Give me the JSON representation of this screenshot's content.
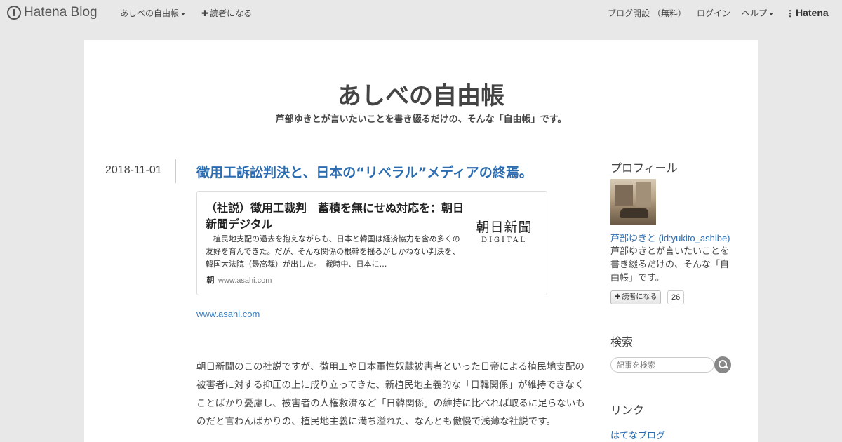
{
  "topbar": {
    "brand": "Hatena Blog",
    "blog_menu": "あしべの自由帳",
    "subscribe": "読者になる",
    "open_blog": "ブログ開設 （無料）",
    "login": "ログイン",
    "help": "ヘルプ",
    "hatena": "Hatena"
  },
  "blog": {
    "title": "あしべの自由帳",
    "description": "芦部ゆきとが言いたいことを書き綴るだけの、そんな「自由帳」です。"
  },
  "entry": {
    "date": "2018-11-01",
    "title": "徴用工訴訟判決と、日本の“リベラル”メディアの終焉。",
    "embed": {
      "title": "（社説）徴用工裁判　蓄積を無にせぬ対応を：朝日新聞デジタル",
      "excerpt": "　植民地支配の過去を抱えながらも、日本と韓国は経済協力を含め多くの友好を育んできた。だが、そんな関係の根幹を揺るがしかねない判決を、韓国大法院（最高裁）が出した。　戦時中、日本に…",
      "thumb_main": "朝日新聞",
      "thumb_sub": "DIGITAL",
      "favicon": "朝",
      "domain": "www.asahi.com"
    },
    "source_link": "www.asahi.com",
    "body": "朝日新聞のこの社説ですが、徴用工や日本軍性奴隷被害者といった日帝による植民地支配の被害者に対する抑圧の上に成り立ってきた、新植民地主義的な「日韓関係」が維持できなくことばかり憂慮し、被害者の人権救済など「日韓関係」の維持に比べれば取るに足らないものだと言わんばかりの、植民地主義に満ち溢れた、なんとも傲慢で浅薄な社説です。"
  },
  "sidebar": {
    "profile_heading": "プロフィール",
    "profile_name": "芦部ゆきと (id:yukito_ashibe)",
    "profile_desc": "芦部ゆきとが言いたいことを書き綴るだけの、そんな「自由帳」です。",
    "follow_label": "読者になる",
    "follow_count": "26",
    "search_heading": "検索",
    "search_placeholder": "記事を検索",
    "links_heading": "リンク",
    "link_hatena_blog": "はてなブログ"
  },
  "colors": {
    "link": "#2b6cb0",
    "background": "#e8e8e8",
    "page": "#ffffff"
  }
}
